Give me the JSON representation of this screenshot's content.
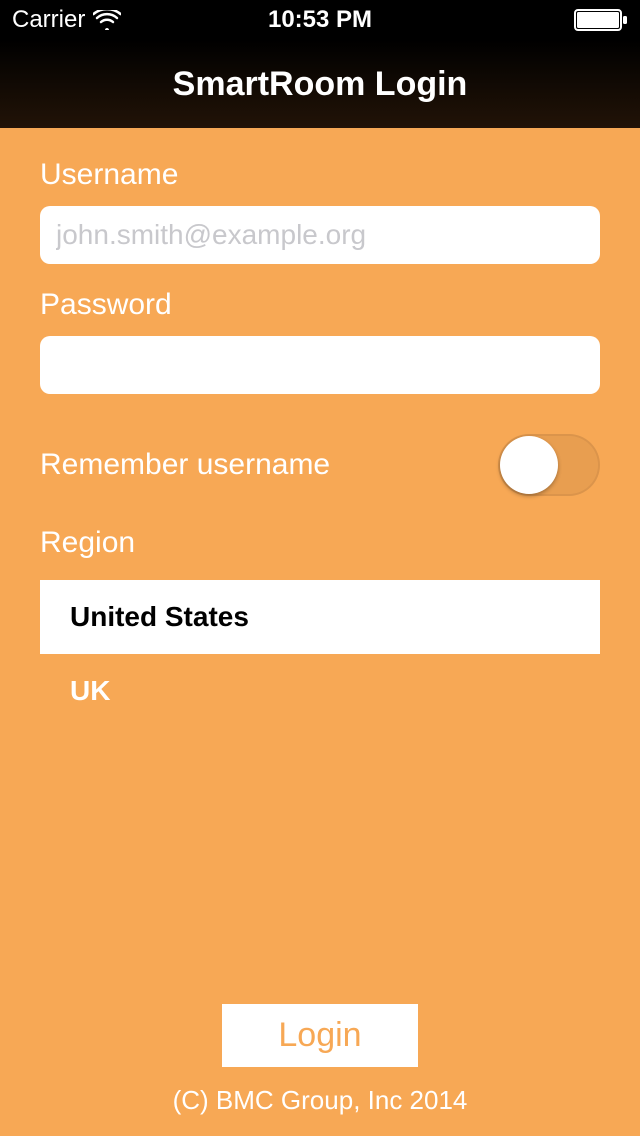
{
  "statusbar": {
    "carrier": "Carrier",
    "time": "10:53 PM"
  },
  "nav": {
    "title": "SmartRoom Login"
  },
  "form": {
    "username_label": "Username",
    "username_placeholder": "john.smith@example.org",
    "username_value": "",
    "password_label": "Password",
    "password_value": "",
    "remember_label": "Remember username",
    "remember_on": false,
    "region_label": "Region",
    "regions": [
      {
        "label": "United States",
        "selected": true
      },
      {
        "label": "UK",
        "selected": false
      }
    ]
  },
  "footer": {
    "login_label": "Login",
    "copyright": "(C) BMC Group, Inc 2014"
  }
}
